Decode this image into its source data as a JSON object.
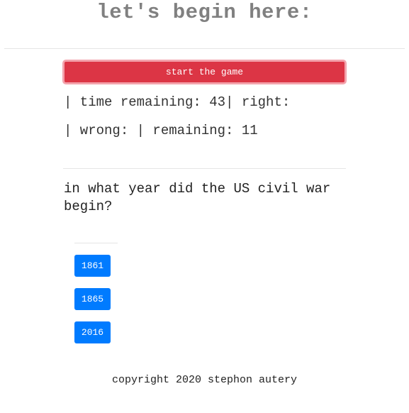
{
  "header": {
    "title": "let's begin here:"
  },
  "controls": {
    "start_label": "start the game"
  },
  "stats": {
    "line1": "| time remaining: 43| right:",
    "line2": "| wrong: | remaining: 11"
  },
  "question": {
    "text": "in what year did the US civil war begin?"
  },
  "answers": [
    "1861",
    "1865",
    "2016"
  ],
  "footer": {
    "text": "copyright 2020 stephon autery"
  },
  "colors": {
    "start_button": "#dc3545",
    "start_button_ring": "#f3a3ac",
    "answer_button": "#007bff",
    "title_text": "#808080"
  }
}
